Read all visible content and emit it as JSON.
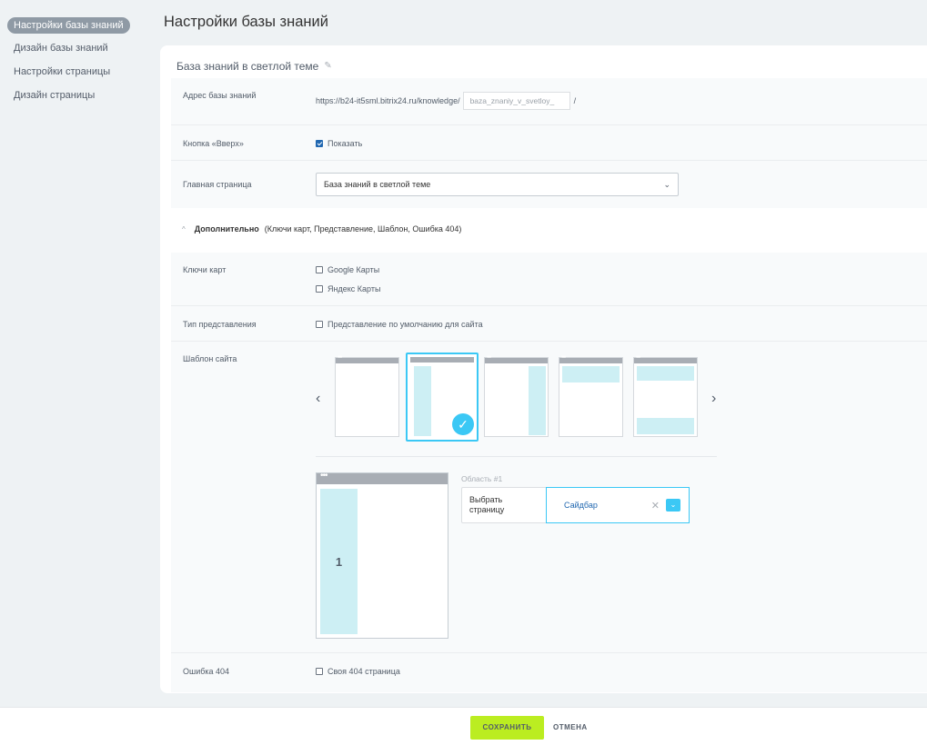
{
  "sidebar": {
    "items": [
      {
        "label": "Настройки базы знаний",
        "active": true
      },
      {
        "label": "Дизайн базы знаний"
      },
      {
        "label": "Настройки страницы"
      },
      {
        "label": "Дизайн страницы"
      }
    ]
  },
  "header": {
    "title": "Настройки базы знаний"
  },
  "kb": {
    "name": "База знаний в светлой теме",
    "address_label": "Адрес базы знаний",
    "address_prefix": "https://b24-it5sml.bitrix24.ru/knowledge/",
    "address_slug": "baza_znaniy_v_svetloy_",
    "address_suffix": "/",
    "up_button_label": "Кнопка «Вверх»",
    "up_button_option": "Показать",
    "up_button_checked": true,
    "home_label": "Главная страница",
    "home_value": "База знаний в светлой теме"
  },
  "advanced": {
    "title": "Дополнительно",
    "subtitle": "(Ключи карт,  Представление,  Шаблон,  Ошибка 404)",
    "map_keys_label": "Ключи карт",
    "map_google": "Google Карты",
    "map_yandex": "Яндекс Карты",
    "view_type_label": "Тип представления",
    "view_type_option": "Представление по умолчанию для сайта",
    "template_label": "Шаблон сайта",
    "selected_template_index": 1,
    "preview_area_number": "1",
    "area_label": "Область #1",
    "area_choose": "Выбрать страницу",
    "area_value": "Сайдбар",
    "error_label": "Ошибка 404",
    "error_option": "Своя 404 страница"
  },
  "footer": {
    "save": "СОХРАНИТЬ",
    "cancel": "ОТМЕНА"
  },
  "colors": {
    "accent": "#3bc8f5",
    "save": "#bbed21",
    "block": "#cdeff4"
  }
}
